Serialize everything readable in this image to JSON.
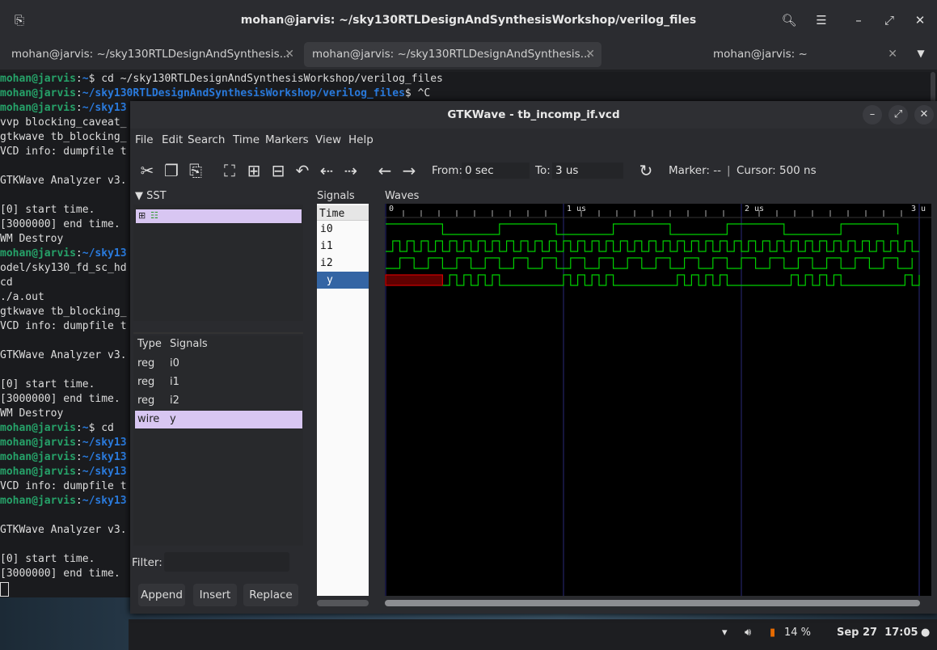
{
  "terminal": {
    "title": "mohan@jarvis: ~/sky130RTLDesignAndSynthesisWorkshop/verilog_files",
    "tabs": [
      {
        "label": "mohan@jarvis: ~/sky130RTLDesignAndSynthesis...",
        "active": false
      },
      {
        "label": "mohan@jarvis: ~/sky130RTLDesignAndSynthesis...",
        "active": true
      },
      {
        "label": "mohan@jarvis: ~",
        "active": false
      }
    ],
    "lines": [
      {
        "user": "mohan@jarvis",
        "path": "~",
        "cmd": "$ cd ~/sky130RTLDesignAndSynthesisWorkshop/verilog_files"
      },
      {
        "user": "mohan@jarvis",
        "path": "~/sky130RTLDesignAndSynthesisWorkshop/verilog_files",
        "cmd": "$ ^C"
      },
      {
        "user": "mohan@jarvis",
        "path": "~/sky13",
        "cmd": ""
      },
      {
        "text": "vvp blocking_caveat_"
      },
      {
        "text": "gtkwave tb_blocking_"
      },
      {
        "text": "VCD info: dumpfile t"
      },
      {
        "text": ""
      },
      {
        "text": "GTKWave Analyzer v3."
      },
      {
        "text": ""
      },
      {
        "text": "[0] start time."
      },
      {
        "text": "[3000000] end time."
      },
      {
        "text": "WM Destroy"
      },
      {
        "user": "mohan@jarvis",
        "path": "~/sky13",
        "cmd": ""
      },
      {
        "text": "odel/sky130_fd_sc_hd"
      },
      {
        "text": "cd"
      },
      {
        "text": "./a.out"
      },
      {
        "text": "gtkwave tb_blocking_"
      },
      {
        "text": "VCD info: dumpfile t"
      },
      {
        "text": ""
      },
      {
        "text": "GTKWave Analyzer v3."
      },
      {
        "text": ""
      },
      {
        "text": "[0] start time."
      },
      {
        "text": "[3000000] end time."
      },
      {
        "text": "WM Destroy"
      },
      {
        "user": "mohan@jarvis",
        "path": "~",
        "cmd": "$ cd"
      },
      {
        "user": "mohan@jarvis",
        "path": "~/sky13",
        "cmd": ""
      },
      {
        "user": "mohan@jarvis",
        "path": "~/sky13",
        "cmd": ""
      },
      {
        "user": "mohan@jarvis",
        "path": "~/sky13",
        "cmd": ""
      },
      {
        "text": "VCD info: dumpfile t"
      },
      {
        "user": "mohan@jarvis",
        "path": "~/sky13",
        "cmd": ""
      },
      {
        "text": ""
      },
      {
        "text": "GTKWave Analyzer v3."
      },
      {
        "text": ""
      },
      {
        "text": "[0] start time."
      },
      {
        "text": "[3000000] end time."
      }
    ]
  },
  "gtkwave": {
    "title": "GTKWave - tb_incomp_if.vcd",
    "menu": [
      "File",
      "Edit",
      "Search",
      "Time",
      "Markers",
      "View",
      "Help"
    ],
    "from_label": "From:",
    "from_value": "0 sec",
    "to_label": "To:",
    "to_value": "3 us",
    "marker_label": "Marker: --",
    "cursor_label": "Cursor: 500 ns",
    "sst_label": "SST",
    "signals_table": {
      "type_header": "Type",
      "signals_header": "Signals",
      "rows": [
        {
          "type": "reg",
          "name": "i0"
        },
        {
          "type": "reg",
          "name": "i1"
        },
        {
          "type": "reg",
          "name": "i2"
        },
        {
          "type": "wire",
          "name": "y"
        }
      ]
    },
    "filter_label": "Filter:",
    "buttons": {
      "append": "Append",
      "insert": "Insert",
      "replace": "Replace"
    },
    "signals_pane_label": "Signals",
    "signals_pane_rows": [
      "Time",
      "i0",
      "i1",
      "i2",
      "y"
    ],
    "waves_label": "Waves",
    "time_ticks": [
      "0",
      "1 us",
      "2 us",
      "3 u"
    ],
    "colors": {
      "wave": "#00d000",
      "undefined": "#d00000",
      "selection": "#d8c6f2",
      "grid": "#2a2a7a"
    }
  },
  "tray": {
    "battery": "14 %",
    "clock": "Sep 27  17:05"
  }
}
